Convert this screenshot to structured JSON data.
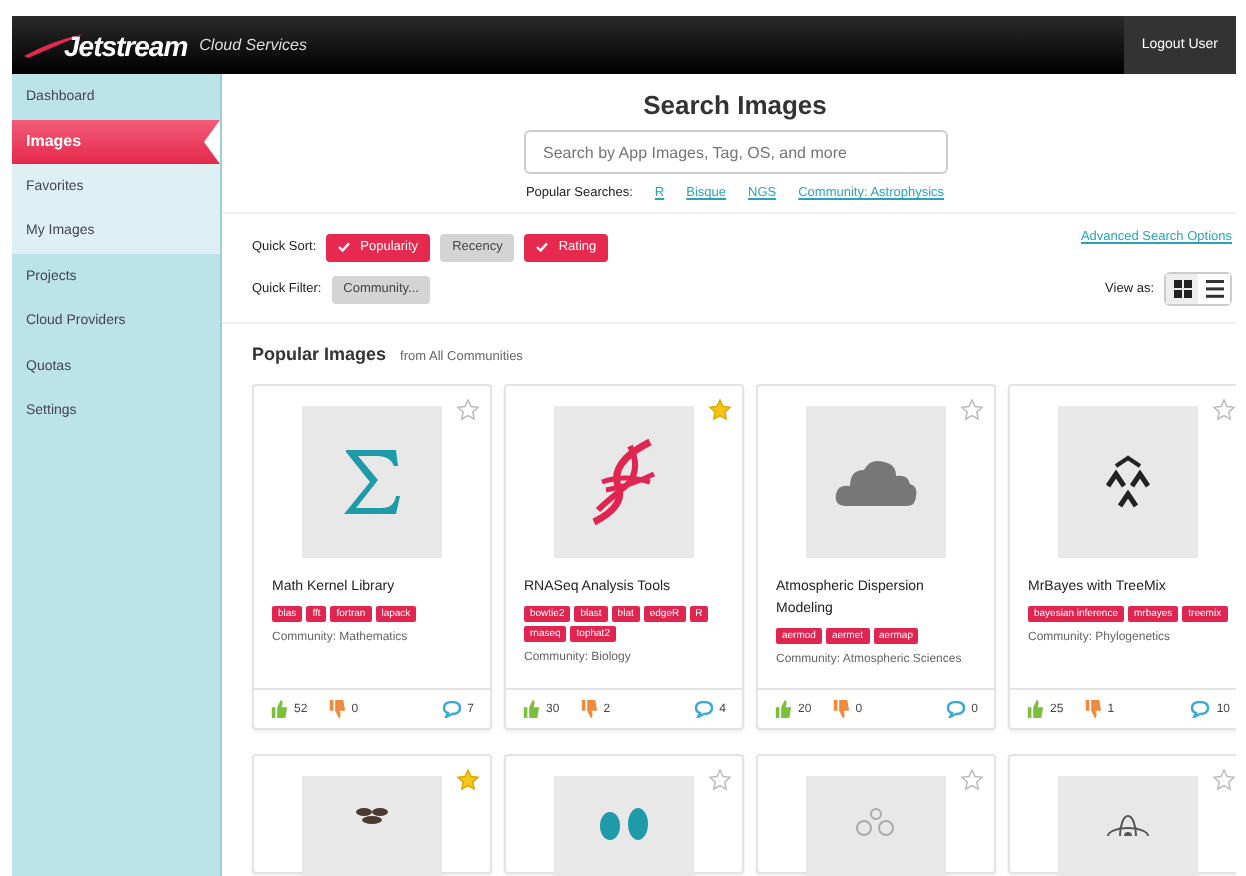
{
  "header": {
    "logo": "Jetstream",
    "subtitle": "Cloud Services",
    "logout": "Logout User"
  },
  "sidebar": {
    "items": [
      {
        "label": "Dashboard",
        "selected": false
      },
      {
        "label": "Images",
        "selected": true,
        "children": [
          {
            "label": "Favorites",
            "selected": false
          },
          {
            "label": "My Images",
            "selected": false
          }
        ]
      },
      {
        "label": "Projects",
        "selected": false
      },
      {
        "label": "Cloud Providers",
        "selected": false
      },
      {
        "label": "Quotas",
        "selected": false
      },
      {
        "label": "Settings",
        "selected": false
      }
    ]
  },
  "search": {
    "title": "Search Images",
    "placeholder": "Search by App Images, Tag, OS, and more",
    "popular_label": "Popular Searches:",
    "popular": [
      "R",
      "Bisque",
      "NGS",
      "Community: Astrophysics"
    ]
  },
  "quick_sort": {
    "label": "Quick Sort:",
    "options": [
      {
        "label": "Popularity",
        "selected": true
      },
      {
        "label": "Recency",
        "selected": false
      },
      {
        "label": "Rating",
        "selected": true
      }
    ]
  },
  "quick_filter": {
    "label": "Quick Filter:",
    "value": "Community..."
  },
  "advanced_link": "Advanced Search Options",
  "view_as": {
    "label": "View as:",
    "options": [
      {
        "kind": "grid",
        "selected": true
      },
      {
        "kind": "list",
        "selected": false
      }
    ]
  },
  "section": {
    "title": "Popular Images",
    "subtitle": "from All Communities"
  },
  "cards": [
    {
      "title": "Math Kernel Library",
      "starred": false,
      "tags": [
        "blas",
        "fft",
        "fortran",
        "lapack"
      ],
      "community": "Community: Mathematics",
      "likes": "52",
      "dislikes": "0",
      "comments": "7"
    },
    {
      "title": "RNASeq Analysis Tools",
      "starred": true,
      "tags": [
        "bowtie2",
        "blast",
        "blat",
        "edgeR",
        "R",
        "rnaseq",
        "tophat2"
      ],
      "community": "Community: Biology",
      "likes": "30",
      "dislikes": "2",
      "comments": "4"
    },
    {
      "title": "Atmospheric Dispersion Modeling",
      "starred": false,
      "tags": [
        "aermod",
        "aermet",
        "aermap"
      ],
      "community": "Community: Atmospheric Sciences",
      "likes": "20",
      "dislikes": "0",
      "comments": "0"
    },
    {
      "title": "MrBayes with TreeMix",
      "starred": false,
      "tags": [
        "bayesian inference",
        "mrbayes",
        "treemix"
      ],
      "community": "Community: Phylogenetics",
      "likes": "25",
      "dislikes": "1",
      "comments": "10"
    },
    {
      "starred": true
    },
    {
      "starred": false
    },
    {
      "starred": false
    },
    {
      "starred": false
    }
  ]
}
